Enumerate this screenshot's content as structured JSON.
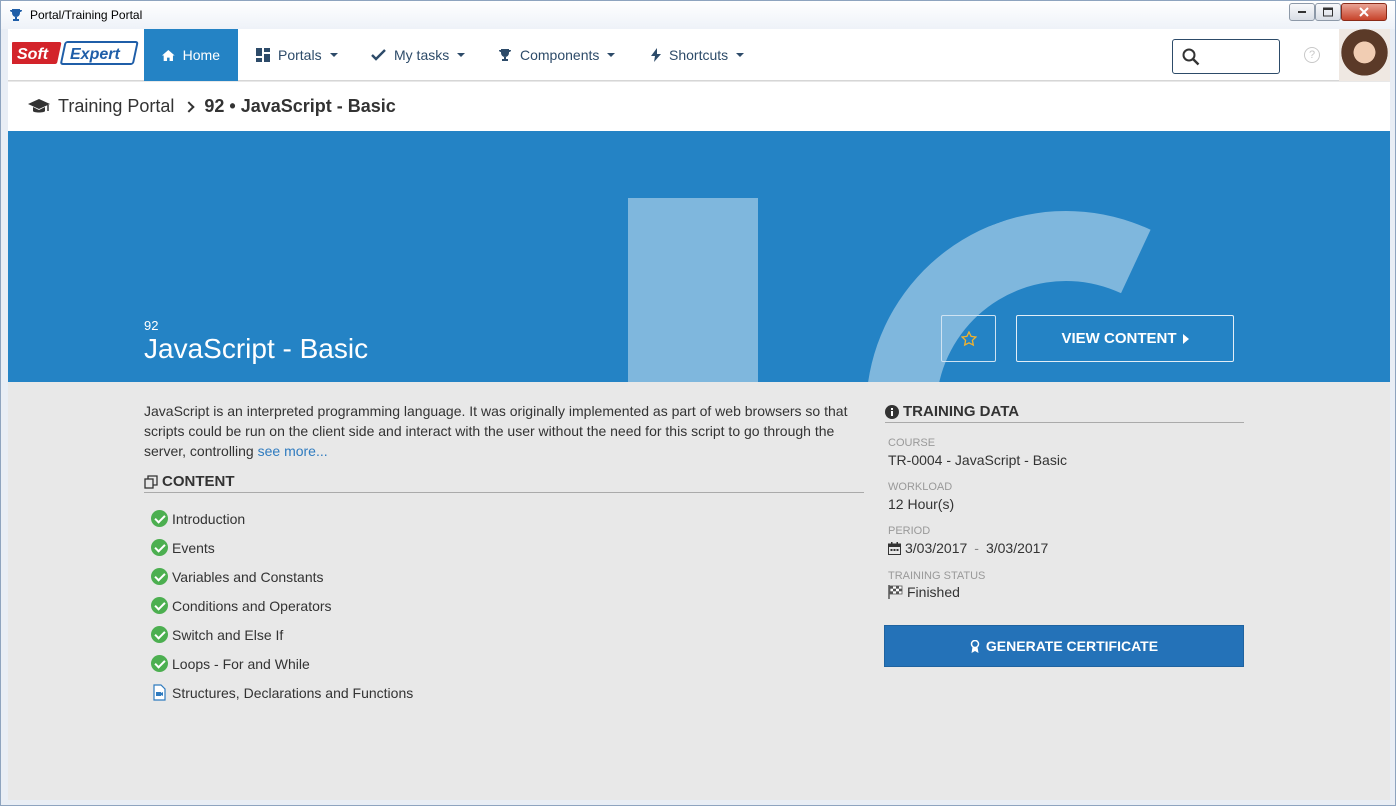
{
  "window": {
    "title": "Portal/Training Portal"
  },
  "brand": {
    "logo_text": "SoftExpert",
    "accent": "#2483c5"
  },
  "nav": {
    "home": "Home",
    "portals": "Portals",
    "my_tasks": "My tasks",
    "components": "Components",
    "shortcuts": "Shortcuts"
  },
  "search": {
    "value": "",
    "placeholder": ""
  },
  "breadcrumb": {
    "root": "Training Portal",
    "current": "92 • JavaScript - Basic"
  },
  "hero": {
    "code": "92",
    "title": "JavaScript - Basic",
    "view_content": "VIEW CONTENT"
  },
  "description": {
    "text": "JavaScript is an interpreted programming language. It was originally implemented as part of web browsers so that scripts could be run on the client side and interact with the user without the need for this script to go through the server, controlling",
    "see_more": "see more..."
  },
  "content": {
    "heading": "CONTENT",
    "items": [
      {
        "label": "Introduction",
        "status": "done"
      },
      {
        "label": "Events",
        "status": "done"
      },
      {
        "label": "Variables and Constants",
        "status": "done"
      },
      {
        "label": "Conditions and Operators",
        "status": "done"
      },
      {
        "label": "Switch and Else If",
        "status": "done"
      },
      {
        "label": "Loops - For and While",
        "status": "done"
      },
      {
        "label": "Structures, Declarations and Functions",
        "status": "video"
      }
    ]
  },
  "training_data": {
    "heading": "TRAINING DATA",
    "course_label": "COURSE",
    "course": "TR-0004 - JavaScript - Basic",
    "workload_label": "WORKLOAD",
    "workload": "12 Hour(s)",
    "period_label": "PERIOD",
    "period_start": "3/03/2017",
    "period_sep": "-",
    "period_end": "3/03/2017",
    "status_label": "TRAINING STATUS",
    "status": "Finished"
  },
  "actions": {
    "generate_certificate": "GENERATE CERTIFICATE"
  }
}
